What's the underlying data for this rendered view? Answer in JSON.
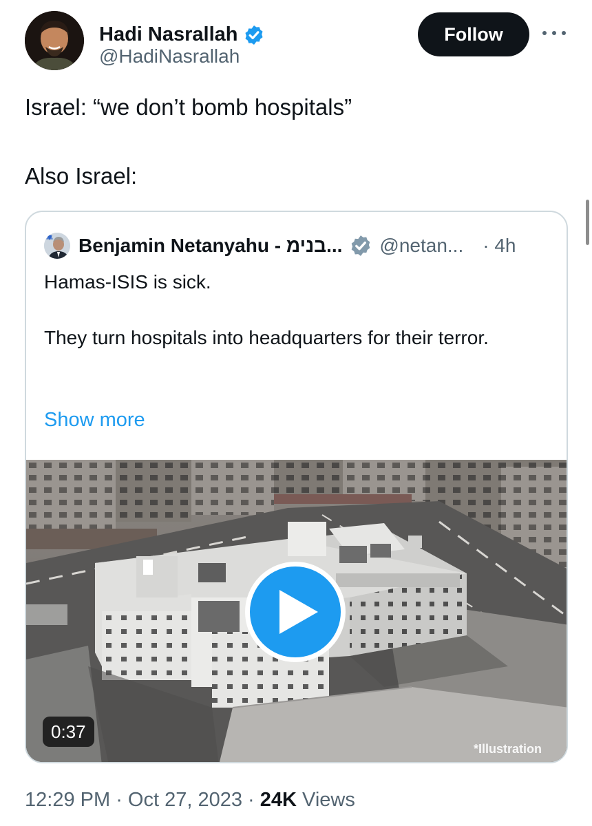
{
  "tweet": {
    "author": {
      "name": "Hadi Nasrallah",
      "handle": "@HadiNasrallah",
      "verified": true
    },
    "follow_label": "Follow",
    "text_line1": "Israel: “we don’t bomb hospitals”",
    "text_line2": "Also Israel:",
    "meta": {
      "time": "12:29 PM",
      "separator1": " · ",
      "date": "Oct 27, 2023",
      "separator2": " · ",
      "views_count": "24K",
      "views_label": " Views"
    }
  },
  "quoted_tweet": {
    "author_name": "Benjamin Netanyahu - בנימ...",
    "handle": "@netan...",
    "time": "· 4h",
    "text_para1": "Hamas-ISIS is sick.",
    "text_para2": "They turn hospitals into headquarters for their terror.",
    "show_more_label": "Show more",
    "video": {
      "duration": "0:37",
      "watermark": "*Illustration"
    }
  },
  "colors": {
    "accent": "#1d9bf0",
    "text": "#0f1419",
    "secondary_text": "#536471",
    "border": "#cfd9de",
    "verified_badge": "#1d9bf0",
    "gray_badge": "#829aab"
  },
  "icons": [
    "verified-badge-icon",
    "gray-verified-badge-icon",
    "more-options-icon",
    "play-icon"
  ]
}
